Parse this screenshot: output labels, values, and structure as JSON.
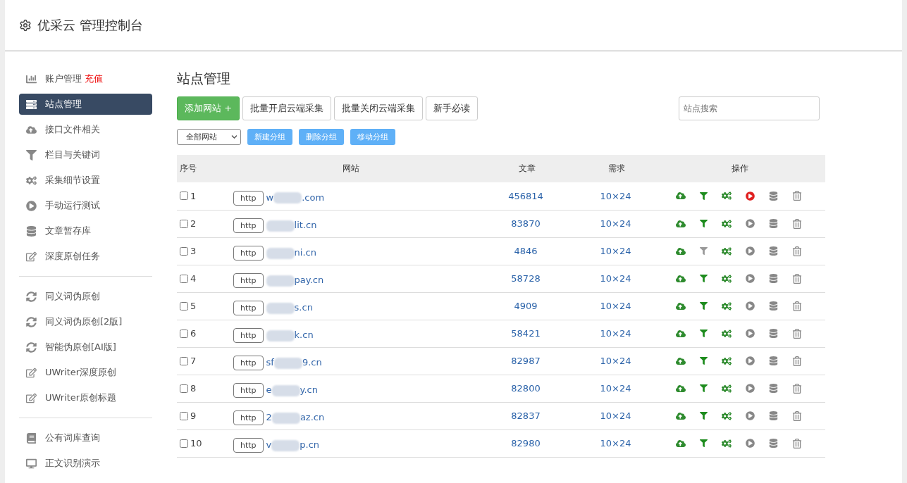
{
  "header": {
    "title": "优采云 管理控制台"
  },
  "sidebar": {
    "groups": [
      [
        {
          "kind": "chart",
          "label": "账户管理",
          "badge": "充值",
          "selected": false
        },
        {
          "kind": "server",
          "label": "站点管理",
          "selected": true
        },
        {
          "kind": "cloud",
          "label": "接口文件相关",
          "selected": false
        },
        {
          "kind": "filter",
          "label": "栏目与关键词",
          "selected": false
        },
        {
          "kind": "gears",
          "label": "采集细节设置",
          "selected": false
        },
        {
          "kind": "play",
          "label": "手动运行测试",
          "selected": false
        },
        {
          "kind": "database",
          "label": "文章暂存库",
          "selected": false
        },
        {
          "kind": "edit",
          "label": "深度原创任务",
          "selected": false
        }
      ],
      [
        {
          "kind": "sync",
          "label": "同义词伪原创",
          "selected": false
        },
        {
          "kind": "sync",
          "label": "同义词伪原创[2版]",
          "selected": false
        },
        {
          "kind": "sync",
          "label": "智能伪原创[AI版]",
          "selected": false
        },
        {
          "kind": "edit",
          "label": "UWriter深度原创",
          "selected": false
        },
        {
          "kind": "edit",
          "label": "UWriter原创标题",
          "selected": false
        }
      ],
      [
        {
          "kind": "book",
          "label": "公有词库查询",
          "selected": false
        },
        {
          "kind": "desktop",
          "label": "正文识别演示",
          "selected": false
        }
      ]
    ]
  },
  "page": {
    "title": "站点管理",
    "add_button": "添加网站 +",
    "buttons": [
      "批量开启云端采集",
      "批量关闭云端采集",
      "新手必读"
    ],
    "search": {
      "placeholder": "站点搜索"
    },
    "filter_select": "全部网站",
    "group_buttons": [
      "新建分组",
      "删除分组",
      "移动分组"
    ]
  },
  "table": {
    "columns": [
      "序号",
      "网站",
      "文章",
      "需求",
      "操作"
    ],
    "rows": [
      {
        "checked": false,
        "number": "1",
        "scheme": "http",
        "url_start": "w",
        "url_end": ".com",
        "articles": "456814",
        "demand": "10×24",
        "filter_on": true,
        "running": true
      },
      {
        "checked": false,
        "number": "2",
        "scheme": "http",
        "url_end": "lit.cn",
        "articles": "83870",
        "demand": "10×24",
        "filter_on": true,
        "running": false
      },
      {
        "checked": false,
        "number": "3",
        "scheme": "http",
        "url_end": "ni.cn",
        "articles": "4846",
        "demand": "10×24",
        "filter_on": false,
        "running": false
      },
      {
        "checked": false,
        "number": "4",
        "scheme": "http",
        "url_end": "pay.cn",
        "articles": "58728",
        "demand": "10×24",
        "filter_on": true,
        "running": false
      },
      {
        "checked": false,
        "number": "5",
        "scheme": "http",
        "url_end": "s.cn",
        "articles": "4909",
        "demand": "10×24",
        "filter_on": true,
        "running": false
      },
      {
        "checked": false,
        "number": "6",
        "scheme": "http",
        "url_end": "k.cn",
        "articles": "58421",
        "demand": "10×24",
        "filter_on": true,
        "running": false
      },
      {
        "checked": false,
        "number": "7",
        "scheme": "http",
        "url_start": "sf",
        "url_end": "9.cn",
        "articles": "82987",
        "demand": "10×24",
        "filter_on": true,
        "running": false
      },
      {
        "checked": false,
        "number": "8",
        "scheme": "http",
        "url_start": "e",
        "url_end": "y.cn",
        "articles": "82800",
        "demand": "10×24",
        "filter_on": true,
        "running": false
      },
      {
        "checked": false,
        "number": "9",
        "scheme": "http",
        "url_start": "2",
        "url_end": "az.cn",
        "articles": "82837",
        "demand": "10×24",
        "filter_on": true,
        "running": false
      },
      {
        "checked": false,
        "number": "10",
        "scheme": "http",
        "url_start": "v",
        "url_end": "p.cn",
        "articles": "82980",
        "demand": "10×24",
        "filter_on": true,
        "running": false
      }
    ]
  }
}
